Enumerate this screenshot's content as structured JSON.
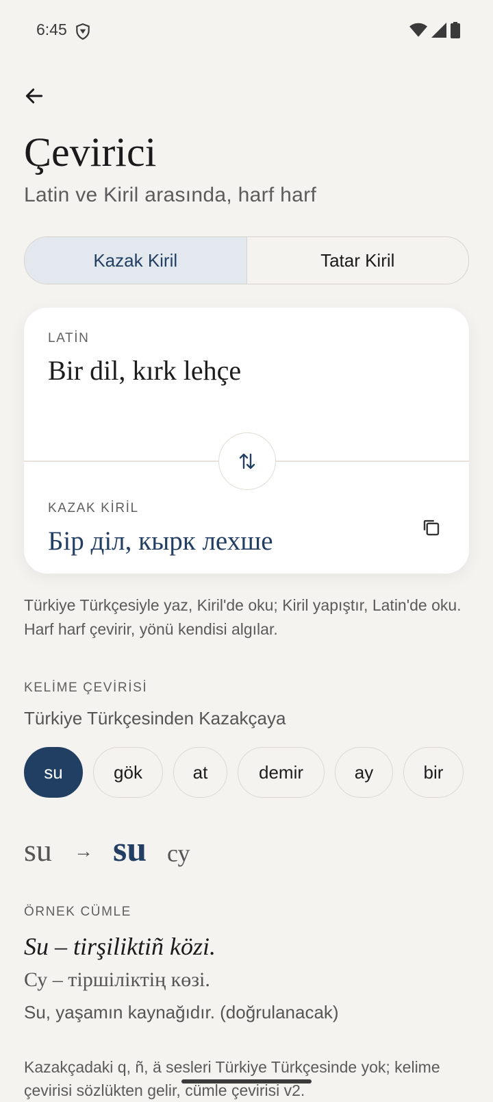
{
  "status": {
    "time": "6:45"
  },
  "header": {
    "title": "Çevirici",
    "subtitle": "Latin ve Kiril arasında, harf harf"
  },
  "tabs": [
    {
      "label": "Kazak Kiril",
      "selected": true
    },
    {
      "label": "Tatar Kiril",
      "selected": false
    }
  ],
  "card": {
    "source_label": "LATİN",
    "source_text": "Bir dil, kırk lehçe",
    "target_label": "KAZAK KİRİL",
    "target_text": "Бір діл, кырк лехше"
  },
  "help_text": "Türkiye Türkçesiyle yaz, Kiril'de oku; Kiril yapıştır, Latin'de oku. Harf harf çevirir, yönü kendisi algılar.",
  "word": {
    "section_label": "KELİME ÇEVİRİSİ",
    "subtitle": "Türkiye Türkçesinden Kazakçaya",
    "chips": [
      "su",
      "gök",
      "at",
      "demir",
      "ay",
      "bir"
    ],
    "selected_chip": "su",
    "result_source": "su",
    "result_arrow": "→",
    "result_target": "su",
    "result_kiril": "су"
  },
  "example": {
    "label": "ÖRNEK CÜMLE",
    "latin": "Su – tirşiliktiñ közi.",
    "kiril": "Су – тіршіліктің көзі.",
    "turkish": "Su, yaşamın kaynağıdır. (doğrulanacak)"
  },
  "note": "Kazakçadaki q, ñ, ä sesleri Türkiye Türkçesinde yok; kelime çevirisi sözlükten gelir, cümle çevirisi v2.",
  "colors": {
    "accent": "#213f62",
    "background": "#f4f3ef"
  }
}
